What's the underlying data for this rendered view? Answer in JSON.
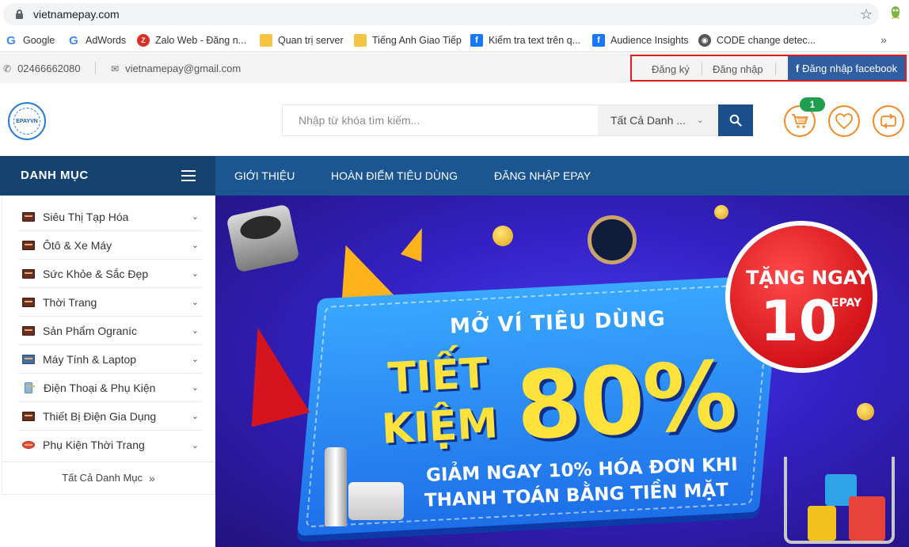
{
  "browser": {
    "url": "vietnamepay.com",
    "bookmarks": [
      {
        "label": "Google",
        "icon": "google-icon"
      },
      {
        "label": "AdWords",
        "icon": "google-icon"
      },
      {
        "label": "Zalo Web - Đăng n...",
        "icon": "zalo-icon"
      },
      {
        "label": "Quan trị server",
        "icon": "folder-icon"
      },
      {
        "label": "Tiếng Anh Giao Tiếp",
        "icon": "folder-icon"
      },
      {
        "label": "Kiểm tra text trên q...",
        "icon": "facebook-icon"
      },
      {
        "label": "Audience Insights",
        "icon": "facebook-icon"
      },
      {
        "label": "CODE change detec...",
        "icon": "globe-icon"
      }
    ],
    "more_label": "»"
  },
  "topbar": {
    "phone": "02466662080",
    "email": "vietnamepay@gmail.com",
    "register": "Đăng ký",
    "login": "Đăng nhập",
    "facebook_login": "Đăng nhập facebook"
  },
  "header": {
    "logo_text": "EPAYVN",
    "search_placeholder": "Nhập từ khóa tìm kiếm...",
    "category_select": "Tất Cả Danh ...",
    "cart_count": "1"
  },
  "nav": {
    "category_title": "DANH MỤC",
    "items": [
      "GIỚI THIỆU",
      "HOÀN ĐIỂM TIÊU DÙNG",
      "ĐĂNG NHẬP EPAY"
    ]
  },
  "sidebar": {
    "items": [
      {
        "label": "Siêu Thị Tạp Hóa",
        "icon": "grocery-icon"
      },
      {
        "label": "Ôtô & Xe Máy",
        "icon": "car-icon"
      },
      {
        "label": "Sức Khỏe & Sắc Đẹp",
        "icon": "health-icon"
      },
      {
        "label": "Thời Trang",
        "icon": "fashion-icon"
      },
      {
        "label": "Sản Phẩm Ograníc",
        "icon": "organic-icon"
      },
      {
        "label": "Máy Tính & Laptop",
        "icon": "laptop-icon"
      },
      {
        "label": "Điện Thoại & Phụ Kiện",
        "icon": "phone-icon"
      },
      {
        "label": "Thiết Bị Điện Gia Dụng",
        "icon": "appliance-icon"
      },
      {
        "label": "Phụ Kiện Thời Trang",
        "icon": "lips-icon"
      }
    ],
    "all_categories": "Tất Cả Danh Mục"
  },
  "banner": {
    "line1": "MỞ VÍ TIÊU DÙNG",
    "line2": "TIẾT",
    "line3": "KIỆM",
    "percent": "80%",
    "line4": "GIẢM NGAY 10% HÓA ĐƠN KHI",
    "line5": "THANH TOÁN BẰNG TIỀN MẶT",
    "promo_top": "TẶNG NGAY",
    "promo_number": "10",
    "promo_unit": "EPAY"
  },
  "colors": {
    "nav_bg": "#1b5592",
    "category_bg": "#15426f",
    "accent_orange": "#f08a24",
    "facebook_blue": "#2f5ea3",
    "highlight_red": "#e01b22",
    "badge_green": "#1e9e4e"
  }
}
